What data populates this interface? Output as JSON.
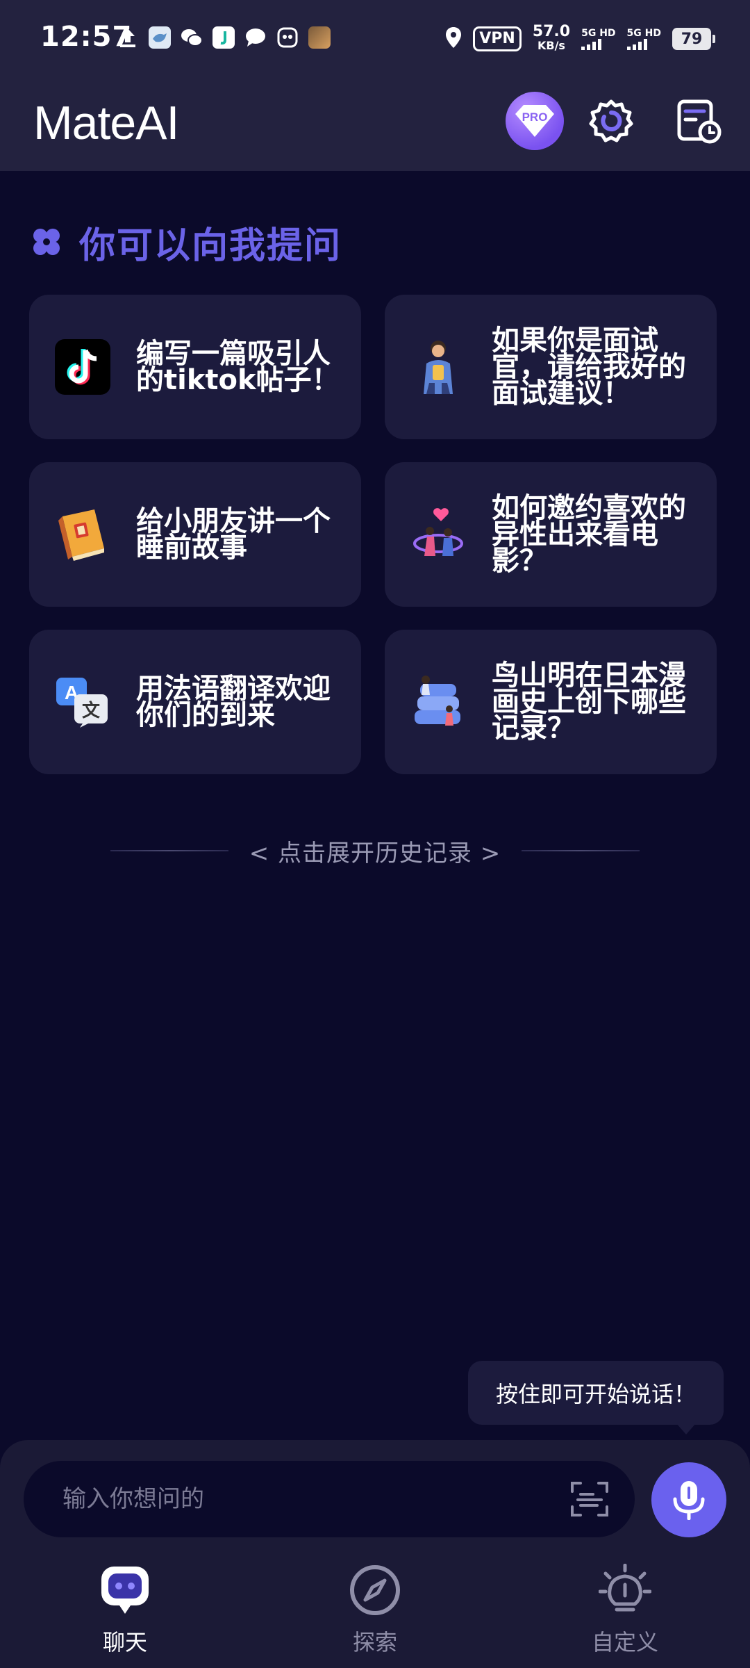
{
  "status_bar": {
    "time": "12:57",
    "vpn": "VPN",
    "net_speed_value": "57.0",
    "net_speed_unit": "KB/s",
    "sim1_label": "5G HD",
    "sim2_label": "5G HD",
    "battery": "79"
  },
  "header": {
    "title": "MateAI",
    "pro_label": "PRO"
  },
  "suggestions": {
    "title": "你可以向我提问",
    "cards": [
      {
        "text": "编写一篇吸引人的tiktok帖子！",
        "icon": "tiktok-logo-icon"
      },
      {
        "text": "如果你是面试官，请给我好的面试建议！",
        "icon": "interviewer-figure-icon"
      },
      {
        "text": "给小朋友讲一个睡前故事",
        "icon": "storybook-icon"
      },
      {
        "text": "如何邀约喜欢的异性出来看电影？",
        "icon": "couple-heart-icon"
      },
      {
        "text": "用法语翻译欢迎你们的到来",
        "icon": "translate-icon"
      },
      {
        "text": "鸟山明在日本漫画史上创下哪些记录？",
        "icon": "books-stack-icon"
      }
    ]
  },
  "history": {
    "label": "< 点击展开历史记录 >"
  },
  "voice_tooltip": "按住即可开始说话！",
  "composer": {
    "placeholder": "输入你想问的"
  },
  "bottom_nav": {
    "items": [
      {
        "label": "聊天",
        "icon": "chat-bot-icon",
        "active": true
      },
      {
        "label": "探索",
        "icon": "compass-icon",
        "active": false
      },
      {
        "label": "自定义",
        "icon": "lightbulb-icon",
        "active": false
      }
    ]
  },
  "colors": {
    "background": "#0b0a2a",
    "bar": "#23223f",
    "card": "#1c1b3d",
    "accent": "#6a61ee",
    "section_title": "#6b63e8"
  }
}
